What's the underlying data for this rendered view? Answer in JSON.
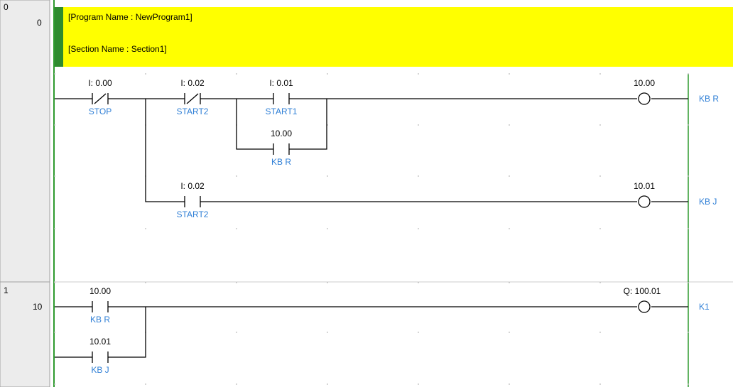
{
  "rungs": [
    {
      "number": "0",
      "step": "0",
      "comment_lines": [
        "[Program Name : NewProgram1]",
        "[Section Name : Section1]"
      ],
      "contacts": [
        {
          "address": "I: 0.00",
          "symbol": "STOP",
          "type": "nc"
        },
        {
          "address": "I: 0.02",
          "symbol": "START2",
          "type": "nc"
        },
        {
          "address": "I: 0.01",
          "symbol": "START1",
          "type": "no"
        },
        {
          "address": "10.00",
          "symbol": "KB R",
          "type": "no"
        },
        {
          "address": "I: 0.02",
          "symbol": "START2",
          "type": "no"
        }
      ],
      "coils": [
        {
          "address": "10.00",
          "symbol": "KB R"
        },
        {
          "address": "10.01",
          "symbol": "KB J"
        }
      ]
    },
    {
      "number": "1",
      "step": "10",
      "contacts": [
        {
          "address": "10.00",
          "symbol": "KB R",
          "type": "no"
        },
        {
          "address": "10.01",
          "symbol": "KB J",
          "type": "no"
        }
      ],
      "coils": [
        {
          "address": "Q: 100.01",
          "symbol": "K1"
        }
      ]
    }
  ],
  "colors": {
    "comment_bg": "#ffff00",
    "comment_marker": "#2e8b2e",
    "rail": "#2e9a2e",
    "symbol_text": "#2f7fd6",
    "gutter_bg": "#f0f0f0",
    "grid_dot": "#b8b8b8"
  }
}
